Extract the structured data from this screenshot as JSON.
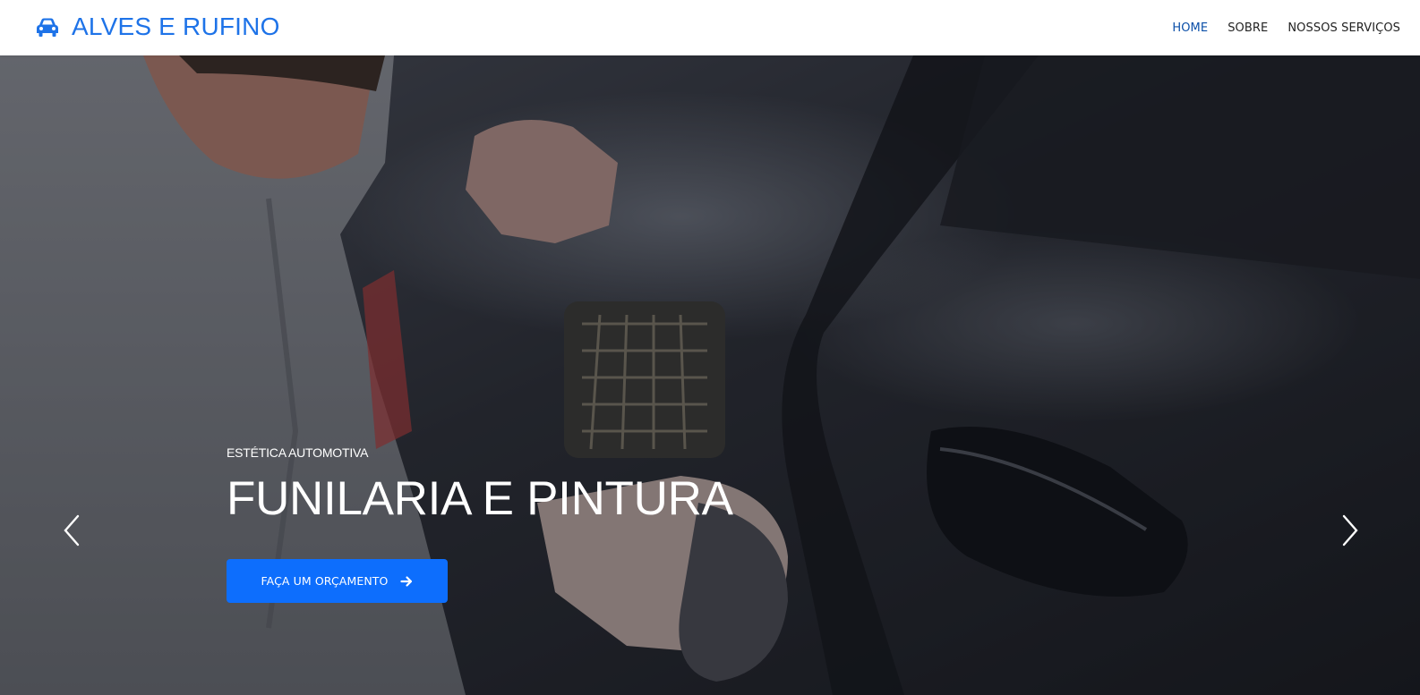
{
  "brand": {
    "name": "ALVES E RUFINO",
    "icon": "car-icon",
    "color": "#1e73e8"
  },
  "nav": {
    "items": [
      {
        "label": "HOME",
        "active": true
      },
      {
        "label": "SOBRE",
        "active": false
      },
      {
        "label": "NOSSOS SERVIÇOS",
        "active": false
      }
    ]
  },
  "hero": {
    "eyebrow": "ESTÉTICA AUTOMOTIVA",
    "headline": "FUNILARIA E PINTURA",
    "cta_label": "FAÇA UM ORÇAMENTO",
    "cta_icon": "arrow-right-icon",
    "cta_color": "#0d6efd",
    "prev_icon": "chevron-left-icon",
    "next_icon": "chevron-right-icon"
  }
}
